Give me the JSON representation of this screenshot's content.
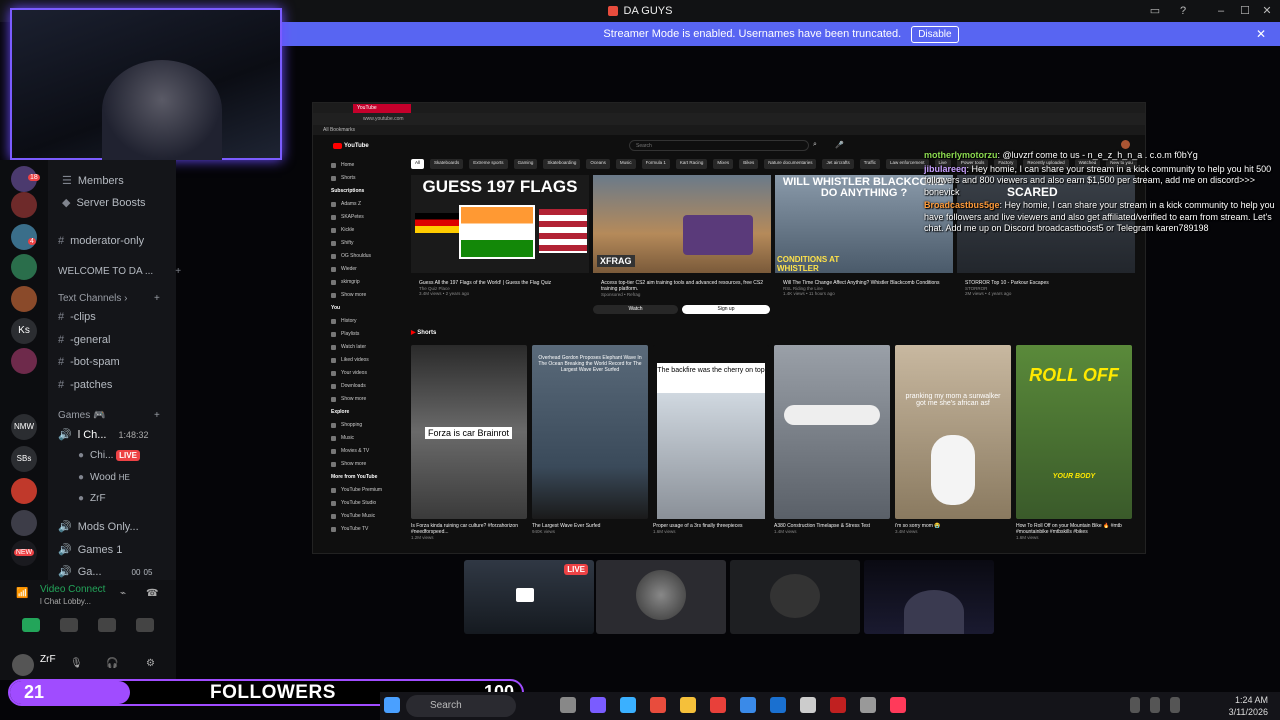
{
  "window": {
    "title": "DA GUYS",
    "controls": {
      "minimize": "–",
      "maximize": "☐",
      "close": "✕"
    }
  },
  "streamer_bar": {
    "message": "Streamer Mode is enabled. Usernames have been truncated.",
    "disable_label": "Disable",
    "close_icon": "✕"
  },
  "servers": [
    {
      "label": "",
      "badge": "18"
    },
    {
      "label": ""
    },
    {
      "label": "",
      "badge": "4"
    },
    {
      "label": ""
    },
    {
      "label": ""
    },
    {
      "label": "Ks"
    },
    {
      "label": ""
    },
    {
      "label": "NMW"
    },
    {
      "label": "SBs"
    },
    {
      "label": ""
    },
    {
      "label": ""
    },
    {
      "label": "NEW"
    }
  ],
  "channels": {
    "members": "Members",
    "server_boosts": "Server Boosts",
    "mod_only": "moderator-only",
    "welcome": "WELCOME TO DA ...",
    "text_category": "Text Channels",
    "text": [
      "-clips",
      "-general",
      "-bot-spam",
      "-patches"
    ],
    "games_category": "Games",
    "voice_active": "l Ch...",
    "voice_timer": "1:48:32",
    "voice_users": [
      {
        "name": "Chi...",
        "live": "LIVE"
      },
      {
        "name": "Wood",
        "tag": "HE"
      },
      {
        "name": "ZrF"
      }
    ],
    "voice_other": [
      {
        "name": "Mods Only..."
      },
      {
        "name": "Games 1"
      },
      {
        "name": "Ga...",
        "count_a": "00",
        "count_b": "05"
      }
    ]
  },
  "voice_panel": {
    "status": "Video Connect",
    "sub": "l Chat Lobby...",
    "user": "ZrF"
  },
  "followers": {
    "count": "21",
    "label": "FOLLOWERS",
    "goal": "100"
  },
  "taskbar": {
    "search_placeholder": "Search",
    "time": "1:24 AM",
    "date": "3/11/2026"
  },
  "browser": {
    "tab_title": "YouTube",
    "url": "www.youtube.com",
    "bookmarks": "All Bookmarks",
    "search_placeholder": "Search",
    "logo": "YouTube",
    "sidebar": {
      "main": [
        "Home",
        "Shorts"
      ],
      "subs_header": "Subscriptions",
      "subs": [
        "Adams Z",
        "SKAPetes",
        "Kickle",
        "Shifty",
        "OG Shouldus",
        "Wieder",
        "skimgrip",
        "Show more"
      ],
      "you_header": "You",
      "you": [
        "History",
        "Playlists",
        "Watch later",
        "Liked videos",
        "Your videos",
        "Downloads",
        "Show more"
      ],
      "explore_header": "Explore",
      "explore": [
        "Shopping",
        "Music",
        "Movies & TV",
        "Show more"
      ],
      "more_header": "More from YouTube",
      "more": [
        "YouTube Premium",
        "YouTube Studio",
        "YouTube Music",
        "YouTube TV"
      ]
    },
    "chips": [
      "All",
      "Skateboards",
      "Extreme sports",
      "Gaming",
      "Skateboarding",
      "Oceans",
      "Music",
      "Formula 1",
      "Kart Racing",
      "Mixes",
      "Bikes",
      "Nature documentaries",
      "Jet aircrafts",
      "Traffic",
      "Law enforcement",
      "Live",
      "Power tools",
      "Factory",
      "Recently uploaded",
      "Watched",
      "New to you"
    ],
    "videos": [
      {
        "title": "Guess All the 197 Flags of the World! | Guess the Flag Quiz",
        "channel": "The Quiz Place",
        "meta": "3.4M views • 2 years ago",
        "thumb_text": "GUESS 197 FLAGS"
      },
      {
        "title": "Access top-tier CS2 aim training tools and advanced resources, free CS2 training platform.",
        "channel": "Sponsored",
        "meta": "Sponsored • Refrag",
        "thumb_text": "XFRAG",
        "watch": "Watch",
        "sign_up": "Sign up"
      },
      {
        "title": "Will The Time Change Affect Anything? Whistler Blackcomb Conditions",
        "channel": "RSL Riding the Line",
        "meta": "1.4K views • 11 hours ago",
        "thumb_text": "WILL WHISTLER BLACKCOMB DO ANYTHING ?",
        "thumb_sub": "CONDITIONS AT WHISTLER BLACKCOMB"
      },
      {
        "title": "STORROR Top 10 - Parkour Escapes",
        "channel": "STORROR",
        "meta": "2M views • 4 years ago",
        "thumb_text": "SCARED"
      }
    ],
    "shorts_label": "Shorts",
    "shorts": [
      {
        "title": "Is Forza kinda ruining car culture? #forzahorizon #needforspeed...",
        "meta": "1.2M views",
        "overlay": "Forza is car Brainrot"
      },
      {
        "title": "The Largest Wave Ever Surfed",
        "meta": "940K views",
        "overlay": "Overhead Gordon Proposes Elephant Wave In The Ocean Breaking the World Record for The Largest Wave Ever Surfed"
      },
      {
        "title": "Proper usage of a 3rs finally threepieces",
        "meta": "1.6M views",
        "overlay": "The backfire was the cherry on top"
      },
      {
        "title": "A380 Construction Timelapse & Stress Test",
        "meta": "1.4M views",
        "overlay": ""
      },
      {
        "title": "i'm so sorry mom 😭",
        "meta": "3.4M views",
        "overlay": "pranking my mom a sunwalker got me she's african asf"
      },
      {
        "title": "How To Roll Off on your Mountain Bike 🔥 #mtb #mountainbike #mtbskills #bikes",
        "meta": "1.6M views",
        "overlay": "ROLL OFF",
        "overlay_sub": "YOUR BODY"
      }
    ]
  },
  "chat": [
    {
      "user": "motherlymotorzu",
      "text": ": @luvzrf come to us - n_e_z_h_n_a . c.o.m f0bYg"
    },
    {
      "user": "jibulareeq",
      "text": ": Hey homie, I can share your stream in a kick community to help you hit 500 followers and 800 viewers and also earn $1,500 per stream, add me on discord>>> bonevick"
    },
    {
      "user": "Broadcastbus5ge",
      "text": ": Hey homie, I can share your stream in a kick community to help you have followers and live viewers and also get affiliated/verified to earn from stream. Let's chat. Add me up on Discord broadcastboost5 or Telegram karen789198"
    }
  ],
  "previews": [
    {
      "live": "LIVE"
    },
    {},
    {},
    {}
  ]
}
